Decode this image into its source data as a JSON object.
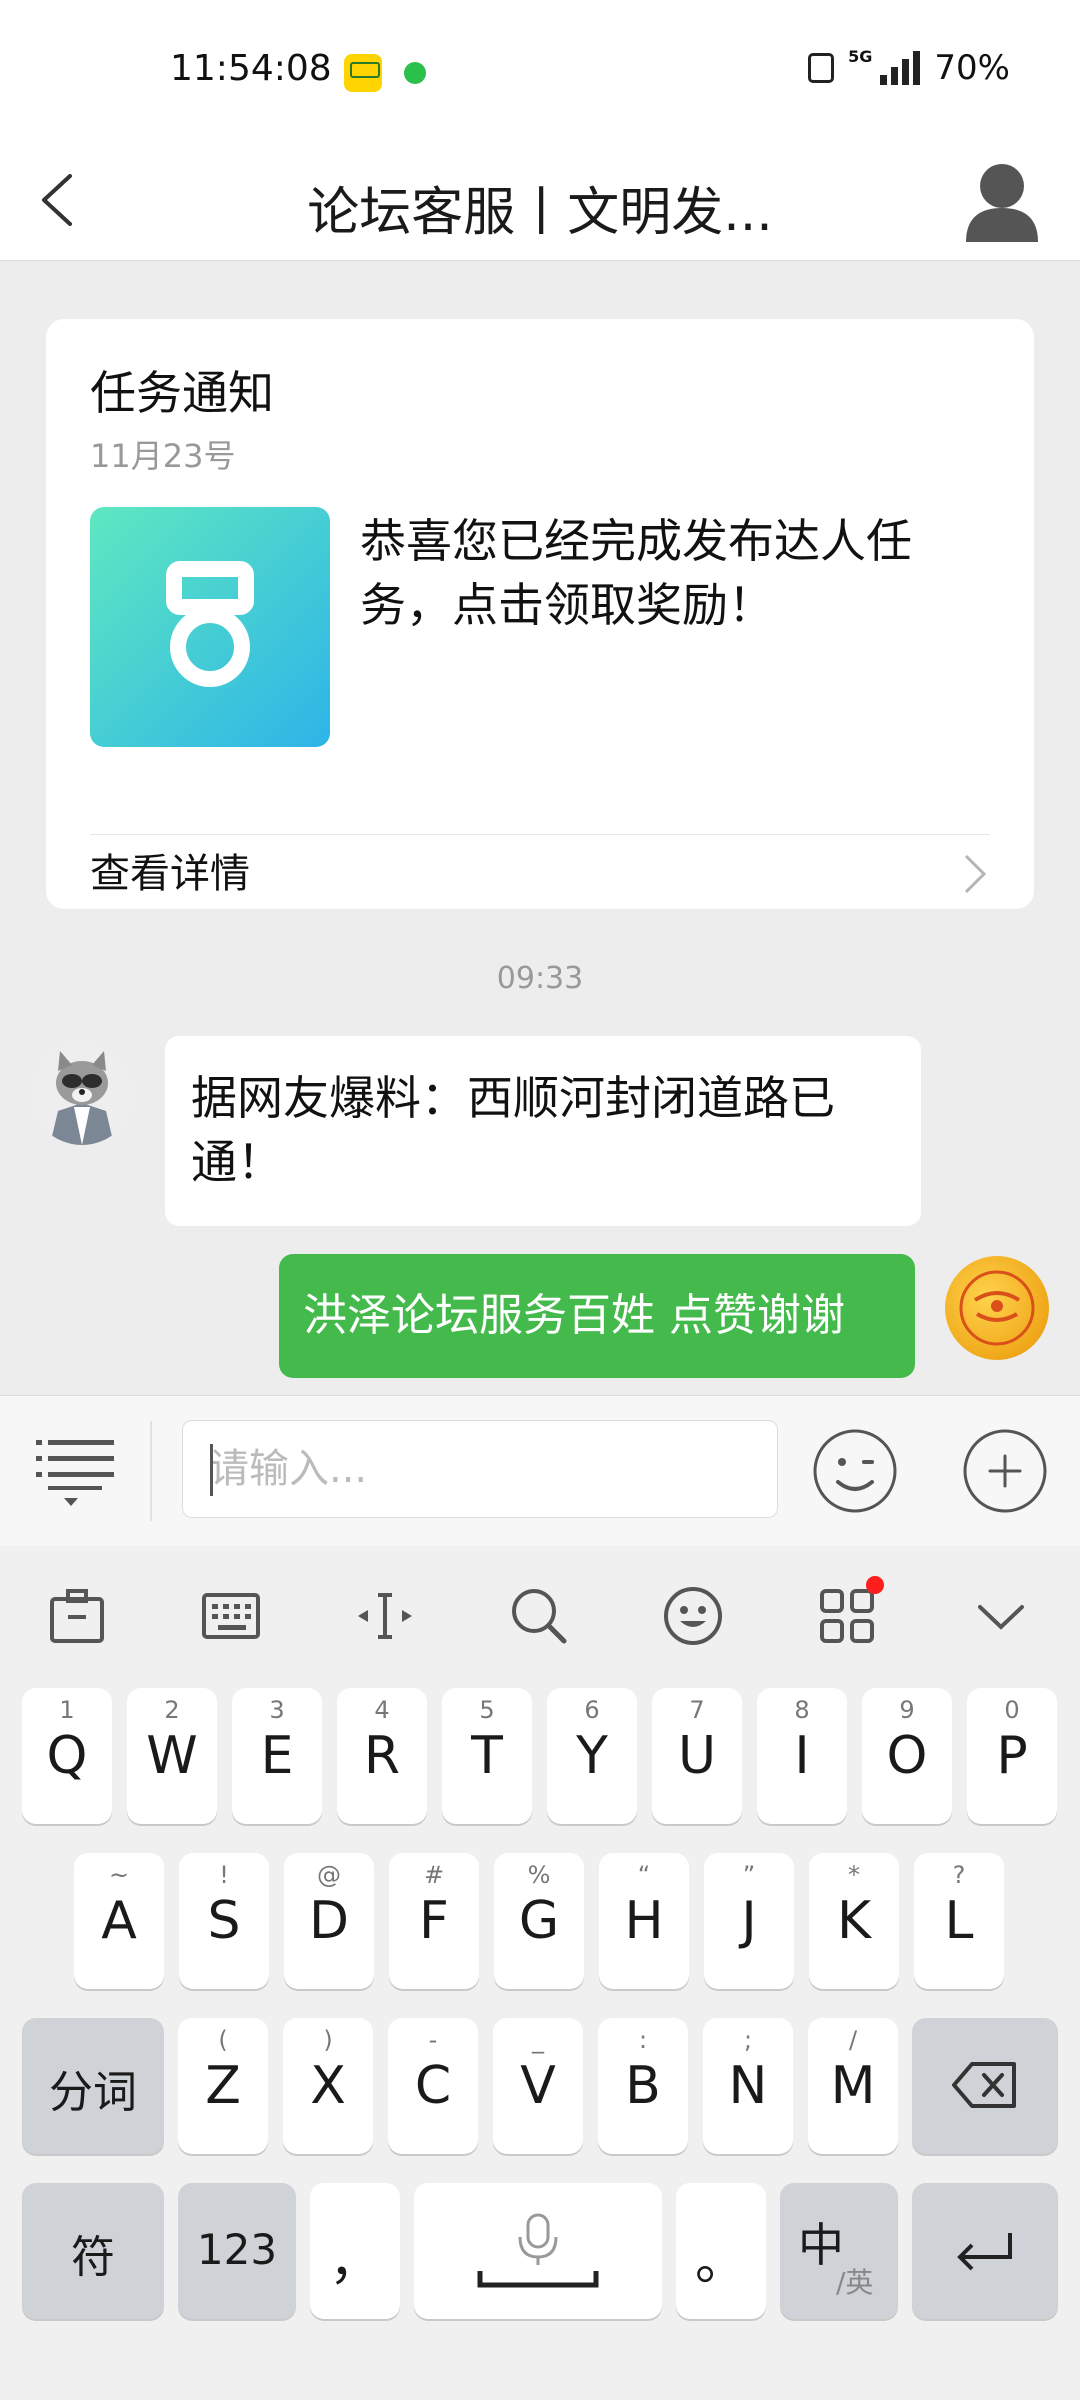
{
  "status_bar": {
    "time": "11:54:08",
    "network": "5G",
    "battery": "70%"
  },
  "header": {
    "title": "论坛客服丨文明发..."
  },
  "notification_card": {
    "title": "任务通知",
    "date": "11月23号",
    "message": "恭喜您已经完成发布达人任务，点击领取奖励！",
    "link_label": "查看详情"
  },
  "chat": {
    "timestamp": "09:33",
    "messages": [
      {
        "side": "left",
        "text": "据网友爆料：西顺河封闭道路已通！"
      },
      {
        "side": "right",
        "text": "洪泽论坛服务百姓 点赞谢谢"
      }
    ]
  },
  "input_bar": {
    "placeholder": "请输入..."
  },
  "keyboard": {
    "row1": [
      {
        "main": "Q",
        "hint": "1"
      },
      {
        "main": "W",
        "hint": "2"
      },
      {
        "main": "E",
        "hint": "3"
      },
      {
        "main": "R",
        "hint": "4"
      },
      {
        "main": "T",
        "hint": "5"
      },
      {
        "main": "Y",
        "hint": "6"
      },
      {
        "main": "U",
        "hint": "7"
      },
      {
        "main": "I",
        "hint": "8"
      },
      {
        "main": "O",
        "hint": "9"
      },
      {
        "main": "P",
        "hint": "0"
      }
    ],
    "row2": [
      {
        "main": "A",
        "hint": "~"
      },
      {
        "main": "S",
        "hint": "!"
      },
      {
        "main": "D",
        "hint": "@"
      },
      {
        "main": "F",
        "hint": "#"
      },
      {
        "main": "G",
        "hint": "%"
      },
      {
        "main": "H",
        "hint": "“"
      },
      {
        "main": "J",
        "hint": "”"
      },
      {
        "main": "K",
        "hint": "*"
      },
      {
        "main": "L",
        "hint": "?"
      }
    ],
    "row3": [
      {
        "main": "Z",
        "hint": "("
      },
      {
        "main": "X",
        "hint": ")"
      },
      {
        "main": "C",
        "hint": "-"
      },
      {
        "main": "V",
        "hint": "_"
      },
      {
        "main": "B",
        "hint": ":"
      },
      {
        "main": "N",
        "hint": ";"
      },
      {
        "main": "M",
        "hint": "/"
      }
    ],
    "segment_key": "分词",
    "symbol_key": "符",
    "number_key": "123",
    "comma_key": "，",
    "period_key": "。",
    "lang_key_main": "中",
    "lang_key_sub": "/英"
  }
}
